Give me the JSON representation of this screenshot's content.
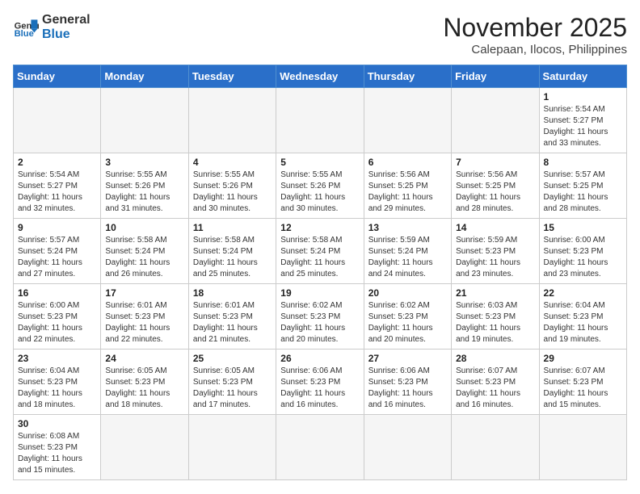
{
  "header": {
    "logo_general": "General",
    "logo_blue": "Blue",
    "month": "November 2025",
    "location": "Calepaan, Ilocos, Philippines"
  },
  "weekdays": [
    "Sunday",
    "Monday",
    "Tuesday",
    "Wednesday",
    "Thursday",
    "Friday",
    "Saturday"
  ],
  "weeks": [
    [
      {
        "day": "",
        "text": ""
      },
      {
        "day": "",
        "text": ""
      },
      {
        "day": "",
        "text": ""
      },
      {
        "day": "",
        "text": ""
      },
      {
        "day": "",
        "text": ""
      },
      {
        "day": "",
        "text": ""
      },
      {
        "day": "1",
        "text": "Sunrise: 5:54 AM\nSunset: 5:27 PM\nDaylight: 11 hours\nand 33 minutes."
      }
    ],
    [
      {
        "day": "2",
        "text": "Sunrise: 5:54 AM\nSunset: 5:27 PM\nDaylight: 11 hours\nand 32 minutes."
      },
      {
        "day": "3",
        "text": "Sunrise: 5:55 AM\nSunset: 5:26 PM\nDaylight: 11 hours\nand 31 minutes."
      },
      {
        "day": "4",
        "text": "Sunrise: 5:55 AM\nSunset: 5:26 PM\nDaylight: 11 hours\nand 30 minutes."
      },
      {
        "day": "5",
        "text": "Sunrise: 5:55 AM\nSunset: 5:26 PM\nDaylight: 11 hours\nand 30 minutes."
      },
      {
        "day": "6",
        "text": "Sunrise: 5:56 AM\nSunset: 5:25 PM\nDaylight: 11 hours\nand 29 minutes."
      },
      {
        "day": "7",
        "text": "Sunrise: 5:56 AM\nSunset: 5:25 PM\nDaylight: 11 hours\nand 28 minutes."
      },
      {
        "day": "8",
        "text": "Sunrise: 5:57 AM\nSunset: 5:25 PM\nDaylight: 11 hours\nand 28 minutes."
      }
    ],
    [
      {
        "day": "9",
        "text": "Sunrise: 5:57 AM\nSunset: 5:24 PM\nDaylight: 11 hours\nand 27 minutes."
      },
      {
        "day": "10",
        "text": "Sunrise: 5:58 AM\nSunset: 5:24 PM\nDaylight: 11 hours\nand 26 minutes."
      },
      {
        "day": "11",
        "text": "Sunrise: 5:58 AM\nSunset: 5:24 PM\nDaylight: 11 hours\nand 25 minutes."
      },
      {
        "day": "12",
        "text": "Sunrise: 5:58 AM\nSunset: 5:24 PM\nDaylight: 11 hours\nand 25 minutes."
      },
      {
        "day": "13",
        "text": "Sunrise: 5:59 AM\nSunset: 5:24 PM\nDaylight: 11 hours\nand 24 minutes."
      },
      {
        "day": "14",
        "text": "Sunrise: 5:59 AM\nSunset: 5:23 PM\nDaylight: 11 hours\nand 23 minutes."
      },
      {
        "day": "15",
        "text": "Sunrise: 6:00 AM\nSunset: 5:23 PM\nDaylight: 11 hours\nand 23 minutes."
      }
    ],
    [
      {
        "day": "16",
        "text": "Sunrise: 6:00 AM\nSunset: 5:23 PM\nDaylight: 11 hours\nand 22 minutes."
      },
      {
        "day": "17",
        "text": "Sunrise: 6:01 AM\nSunset: 5:23 PM\nDaylight: 11 hours\nand 22 minutes."
      },
      {
        "day": "18",
        "text": "Sunrise: 6:01 AM\nSunset: 5:23 PM\nDaylight: 11 hours\nand 21 minutes."
      },
      {
        "day": "19",
        "text": "Sunrise: 6:02 AM\nSunset: 5:23 PM\nDaylight: 11 hours\nand 20 minutes."
      },
      {
        "day": "20",
        "text": "Sunrise: 6:02 AM\nSunset: 5:23 PM\nDaylight: 11 hours\nand 20 minutes."
      },
      {
        "day": "21",
        "text": "Sunrise: 6:03 AM\nSunset: 5:23 PM\nDaylight: 11 hours\nand 19 minutes."
      },
      {
        "day": "22",
        "text": "Sunrise: 6:04 AM\nSunset: 5:23 PM\nDaylight: 11 hours\nand 19 minutes."
      }
    ],
    [
      {
        "day": "23",
        "text": "Sunrise: 6:04 AM\nSunset: 5:23 PM\nDaylight: 11 hours\nand 18 minutes."
      },
      {
        "day": "24",
        "text": "Sunrise: 6:05 AM\nSunset: 5:23 PM\nDaylight: 11 hours\nand 18 minutes."
      },
      {
        "day": "25",
        "text": "Sunrise: 6:05 AM\nSunset: 5:23 PM\nDaylight: 11 hours\nand 17 minutes."
      },
      {
        "day": "26",
        "text": "Sunrise: 6:06 AM\nSunset: 5:23 PM\nDaylight: 11 hours\nand 16 minutes."
      },
      {
        "day": "27",
        "text": "Sunrise: 6:06 AM\nSunset: 5:23 PM\nDaylight: 11 hours\nand 16 minutes."
      },
      {
        "day": "28",
        "text": "Sunrise: 6:07 AM\nSunset: 5:23 PM\nDaylight: 11 hours\nand 16 minutes."
      },
      {
        "day": "29",
        "text": "Sunrise: 6:07 AM\nSunset: 5:23 PM\nDaylight: 11 hours\nand 15 minutes."
      }
    ],
    [
      {
        "day": "30",
        "text": "Sunrise: 6:08 AM\nSunset: 5:23 PM\nDaylight: 11 hours\nand 15 minutes."
      },
      {
        "day": "",
        "text": ""
      },
      {
        "day": "",
        "text": ""
      },
      {
        "day": "",
        "text": ""
      },
      {
        "day": "",
        "text": ""
      },
      {
        "day": "",
        "text": ""
      },
      {
        "day": "",
        "text": ""
      }
    ]
  ]
}
